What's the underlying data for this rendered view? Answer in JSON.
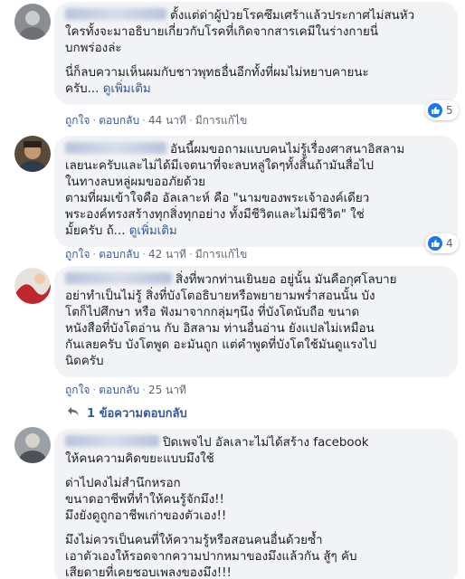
{
  "actions": {
    "like": "ถูกใจ",
    "reply": "ตอบกลับ",
    "edited": "มีการแก้ไข",
    "see_more": "ดูเพิ่มเติม"
  },
  "comments": [
    {
      "lines": [
        "ตั้งแต่ด่าผู้ป่วยโรคซึมเศร้าแล้วประกาศไม่สนหัว",
        "ใครทั้งจะมาอธิบายเกี่ยวกับโรคที่เกิดจากสารเคมีในร่างกายนี่",
        "บกพร่องล่ะ",
        "",
        "นี่ก็ลบความเห็นผมกับชาวพุทธอื่นอีกทั้งที่ผมไม่หยาบคายนะ",
        "ครับ..."
      ],
      "time": "44 นาที",
      "reaction_count": "5"
    },
    {
      "lines": [
        "อันนี้ผมขอถามแบบคนไม่รู้เรื่องศาสนาอิสลาม",
        "เลยนะครับและไม่ได้มีเจตนาที่จะลบหลู่ใดๆทั้งสิ้นถ้ามันสื่อไป",
        "ในทางลบหลู่ผมขออภัยด้วย",
        "ตามที่ผมเข้าใจคือ อัลเลาะห์ คือ \"นามของพระเจ้าองค์เดียว",
        "พระองค์ทรงสร้างทุกสิ่งทุกอย่าง ทั้งมีชีวิตและไม่มีชีวิต\" ใช่",
        "มั้ยครับ ถ้..."
      ],
      "time": "42 นาที",
      "reaction_count": "4"
    },
    {
      "lines": [
        "สิ่งที่พวกท่านเยินยอ อยู่นั้น มันคือกุศโลบาย",
        "อย่าทำเป็นไม่รู้ สิ่งที่บังโตอธิบายหรือพยายามพร่ำสอนนั้น บัง",
        "โตก็ไปศึกษา หรือ ฟังมาจากกลุ่มๆนึง ที่บังโตนับถือ ขนาด",
        "หนังสือที่บังโตอ่าน กับ อิสลาม ท่านอื่นอ่าน ยังแปลไม่เหมือน",
        "กันเลยครับ บังโตพูด อะมันถูก แต่คำพูดที่บังโตใช้มันดูแรงไป",
        "นิดครับ"
      ],
      "time": "25 นาที",
      "replies_label": "1 ข้อความตอบกลับ"
    },
    {
      "lines": [
        "ปิดเพจไป อัลเลาะไม่ได้สร้าง facebook",
        "ให้คนความคิดขยะแบบมึงใช้",
        "",
        "ด่าไปคงไม่สำนึกหรอก",
        "ขนาดอาชีพที่ทำให้คนรู้จักมึง!!",
        "มึงยังดูถูกอาชีพเก่าของตัวเอง!!",
        "",
        "มึงไม่ควรเป็นคนที่ให้ความรู้หรือสอนคนอื่นด้วยซ้ำ",
        "เอาตัวเองให้รอดจากความปากหมาของมึงแล้วกัน สู้ๆ คับ",
        "เสียดายที่เคยชอบเพลงของมึง!!!"
      ]
    }
  ],
  "colors": {
    "bubble": "#f2f3f5",
    "link": "#385898",
    "meta": "#606770",
    "like_blue": "#1877f2"
  },
  "icons": [
    "like-icon",
    "reply-arrow-icon",
    "avatar"
  ]
}
